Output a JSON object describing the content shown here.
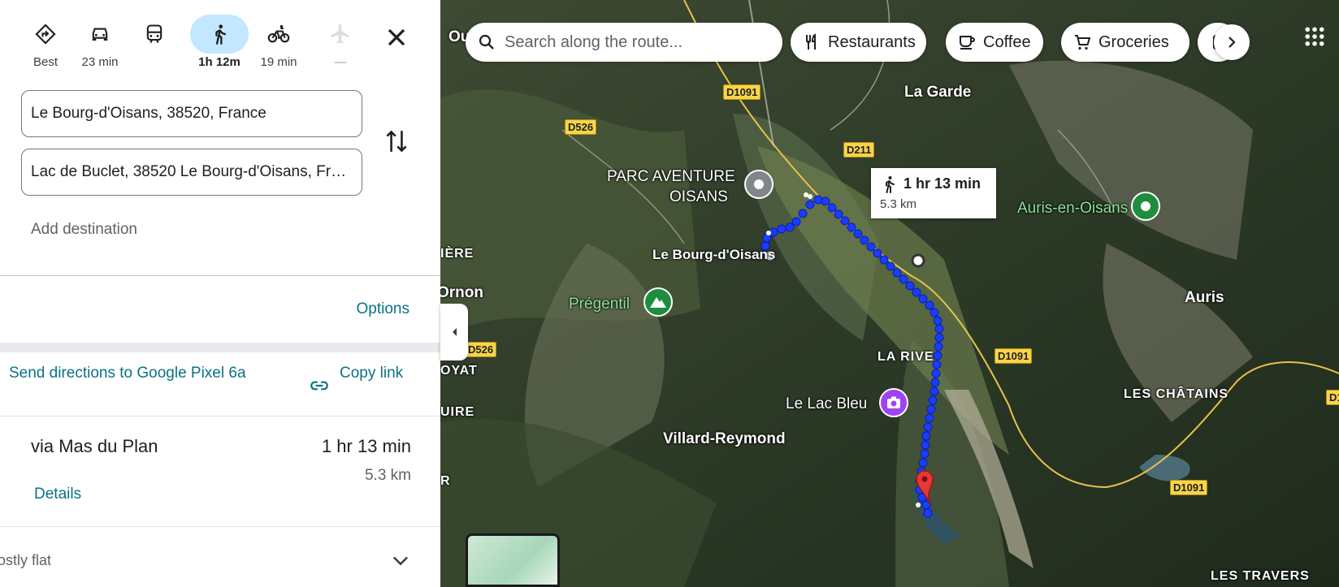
{
  "modes": [
    {
      "name": "best",
      "label": "Best",
      "icon": "directions-icon"
    },
    {
      "name": "car",
      "label": "23 min",
      "icon": "car-icon"
    },
    {
      "name": "transit",
      "label": "",
      "icon": "train-icon"
    },
    {
      "name": "walk",
      "label": "1h 12m",
      "icon": "walk-icon",
      "active": true
    },
    {
      "name": "bike",
      "label": "19 min",
      "icon": "bicycle-icon"
    },
    {
      "name": "flight",
      "label": "—",
      "icon": "plane-icon",
      "disabled": true
    }
  ],
  "inputs": {
    "origin": "Le Bourg-d'Oisans, 38520, France",
    "destination": "Lac de Buclet, 38520 Le Bourg-d'Oisans, France"
  },
  "add_destination": "Add destination",
  "options_label": "Options",
  "send_directions": "Send directions to Google Pixel 6a",
  "copy_link": "Copy link",
  "route": {
    "name": "via Mas du Plan",
    "duration": "1 hr 13 min",
    "distance": "5.3 km",
    "details_label": "Details",
    "terrain": "Mostly flat"
  },
  "map": {
    "search_placeholder": "Search along the route...",
    "chips": [
      "Restaurants",
      "Coffee",
      "Groceries"
    ],
    "duration_box": {
      "time": "1 hr 13 min",
      "distance": "5.3 km"
    },
    "places": {
      "la_garde": "La Garde",
      "parc": "PARC AVENTURE",
      "parc2": "OISANS",
      "bourg": "Le Bourg-d'Oisans",
      "auris_en_oisans": "Auris-en-Oisans",
      "auris": "Auris",
      "pregentil": "Prégentil",
      "la_rive": "LA RIVE",
      "lac_bleu": "Le Lac Bleu",
      "villard": "Villard-Reymond",
      "chatains": "LES CHÂTAINS",
      "travers": "LES TRAVERS",
      "ornon": "Ornon",
      "iere": "IÈRE",
      "oyat": "OYAT",
      "uire": "UIRE",
      "ou": "Ou",
      "r": "R"
    },
    "roads": {
      "d1091_a": "D1091",
      "d526_a": "D526",
      "d211": "D211",
      "d1091_b": "D1091",
      "d1091_c": "D1091",
      "d526_b": "D526",
      "d1_edge": "D1"
    }
  },
  "colors": {
    "accent": "#0b7285",
    "route": "#1a3cff",
    "active_mode_bg": "#c2e7ff",
    "road_label": "#f7d44a"
  }
}
